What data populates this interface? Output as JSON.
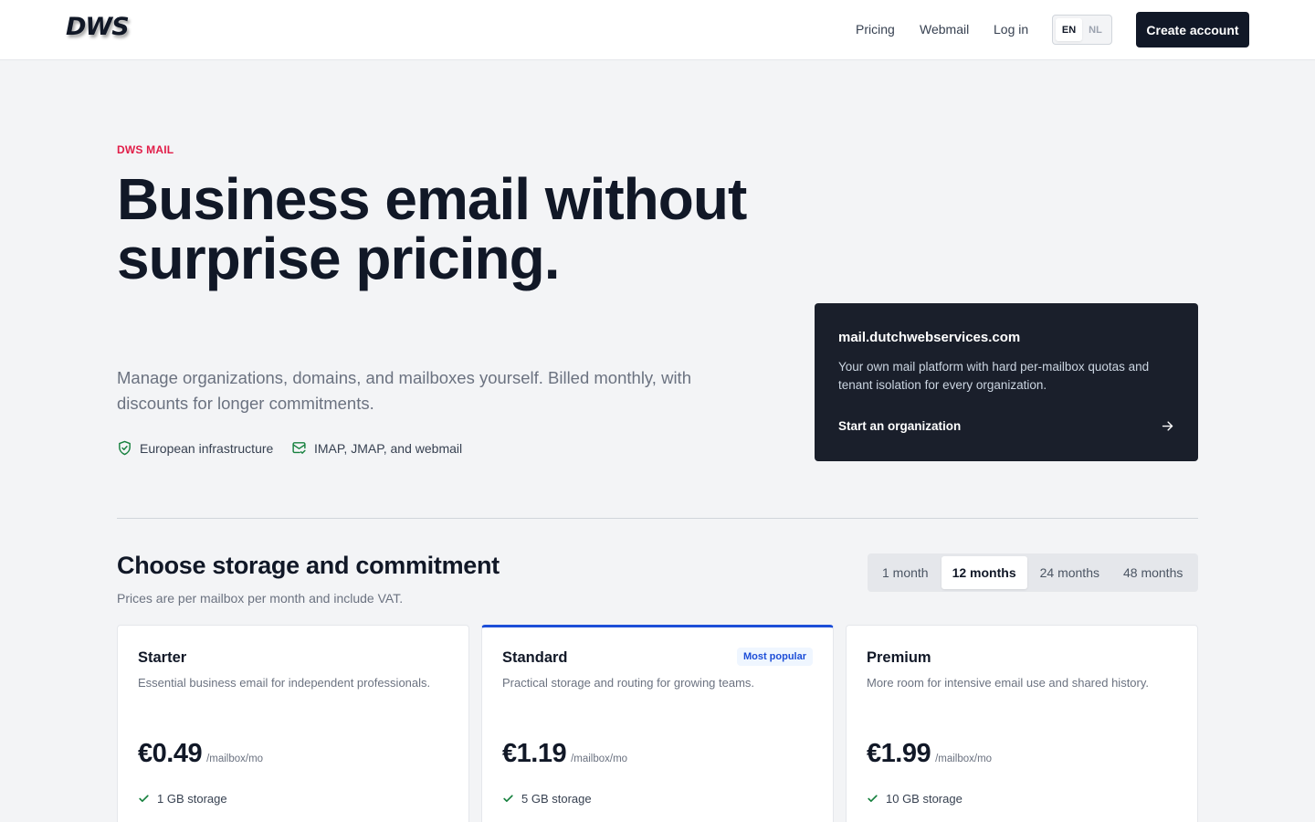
{
  "header": {
    "logo_text": "DWS",
    "nav": {
      "pricing": "Pricing",
      "webmail": "Webmail",
      "login": "Log in"
    },
    "lang": {
      "en": "EN",
      "nl": "NL",
      "selected": "EN"
    },
    "create_account": "Create account"
  },
  "hero": {
    "eyebrow": "DWS MAIL",
    "title": "Business email without surprise pricing.",
    "subtitle": "Manage organizations, domains, and mailboxes yourself. Billed monthly, with discounts for longer commitments.",
    "features": [
      {
        "icon": "shield-check-icon",
        "label": "European infrastructure"
      },
      {
        "icon": "mail-check-icon",
        "label": "IMAP, JMAP, and webmail"
      }
    ]
  },
  "promo_card": {
    "domain": "mail.dutchwebservices.com",
    "description": "Your own mail platform with hard per-mailbox quotas and tenant isolation for every organization.",
    "cta": "Start an organization",
    "cta_icon": "arrow-right-icon"
  },
  "pricing": {
    "title": "Choose storage and commitment",
    "subtitle": "Prices are per mailbox per month and include VAT.",
    "terms": [
      "1 month",
      "12 months",
      "24 months",
      "48 months"
    ],
    "selected_term": "12 months",
    "plans": [
      {
        "name": "Starter",
        "description": "Essential business email for independent professionals.",
        "price": "€0.49",
        "unit": "/mailbox/mo",
        "feature": "1 GB storage"
      },
      {
        "name": "Standard",
        "badge": "Most popular",
        "description": "Practical storage and routing for growing teams.",
        "price": "€1.19",
        "unit": "/mailbox/mo",
        "feature": "5 GB storage"
      },
      {
        "name": "Premium",
        "description": "More room for intensive email use and shared history.",
        "price": "€1.99",
        "unit": "/mailbox/mo",
        "feature": "10 GB storage"
      }
    ]
  },
  "colors": {
    "accent_red": "#e11d48",
    "brand_dark": "#111827",
    "card_dark": "#1a1f2b",
    "featured_blue": "#1d4ed8",
    "icon_green": "#15803d"
  }
}
